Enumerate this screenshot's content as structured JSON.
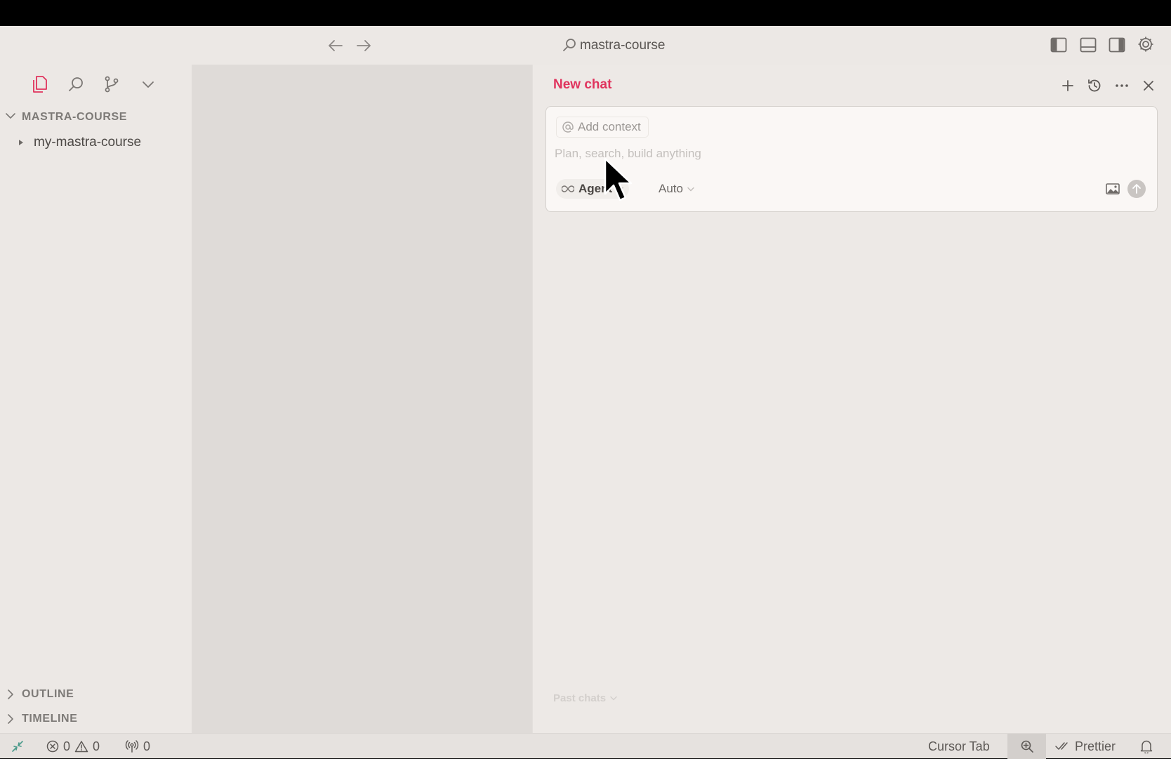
{
  "titlebar": {
    "search_text": "mastra-course",
    "icons": [
      "arrow-left-icon",
      "arrow-right-icon",
      "search-icon",
      "toggle-primary-sidebar-icon",
      "toggle-panel-icon",
      "toggle-secondary-sidebar-icon",
      "gear-icon"
    ]
  },
  "sidebar": {
    "activity_icons": [
      "files-icon",
      "search-icon",
      "source-control-icon",
      "chevron-down-icon"
    ],
    "explorer_title": "MASTRA-COURSE",
    "tree": [
      {
        "label": "my-mastra-course",
        "type": "folder",
        "expanded": false
      }
    ],
    "outline_title": "OUTLINE",
    "timeline_title": "TIMELINE"
  },
  "chat": {
    "title": "New chat",
    "header_icons": [
      "plus-icon",
      "history-icon",
      "more-icon",
      "close-icon"
    ],
    "add_context_label": "Add context",
    "input_placeholder": "Plan, search, build anything",
    "mode_label": "Agent",
    "model_label": "Auto",
    "past_chats_label": "Past chats",
    "accent": "#e0335d"
  },
  "statusbar": {
    "errors": "0",
    "warnings": "0",
    "ports": "0",
    "cursor_tab": "Cursor Tab",
    "prettier": "Prettier"
  }
}
